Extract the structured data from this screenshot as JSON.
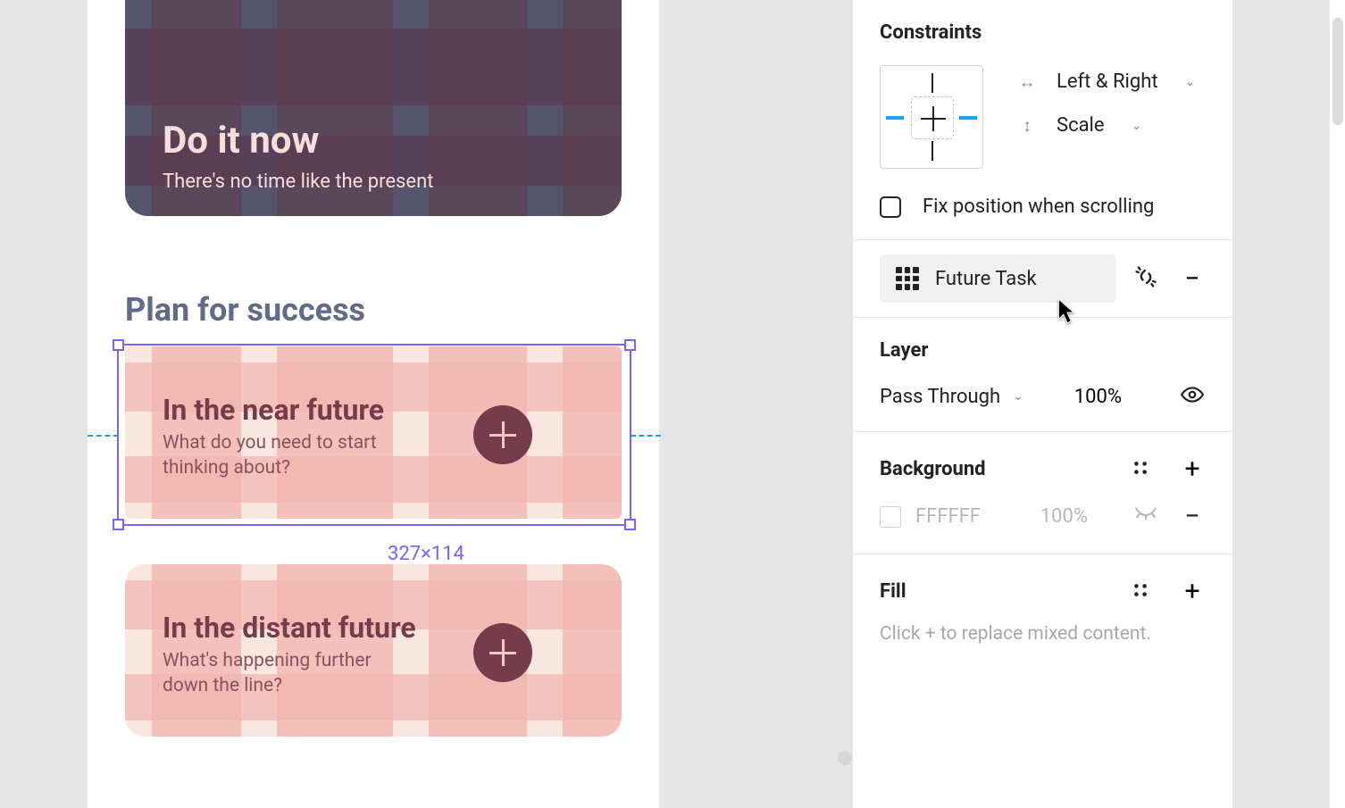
{
  "canvas": {
    "dark_card": {
      "title": "Do it now",
      "subtitle": "There's no time like the present"
    },
    "section_heading": "Plan for success",
    "cards": [
      {
        "title": "In the near future",
        "subtitle": "What do you need to start thinking about?"
      },
      {
        "title": "In the distant future",
        "subtitle": "What's happening further down the line?"
      }
    ],
    "selection_dimensions": "327×114"
  },
  "panel": {
    "constraints": {
      "heading": "Constraints",
      "horizontal": "Left & Right",
      "vertical": "Scale",
      "fix_label": "Fix position when scrolling"
    },
    "component": {
      "name": "Future Task"
    },
    "layer": {
      "heading": "Layer",
      "blend_mode": "Pass Through",
      "opacity": "100%"
    },
    "background": {
      "heading": "Background",
      "hex": "FFFFFF",
      "opacity": "100%"
    },
    "fill": {
      "heading": "Fill",
      "hint": "Click + to replace mixed content."
    }
  },
  "icons": {
    "h_arrow": "↔",
    "v_arrow": "↕",
    "chev": "⌄",
    "minus": "−",
    "plus": "+"
  }
}
